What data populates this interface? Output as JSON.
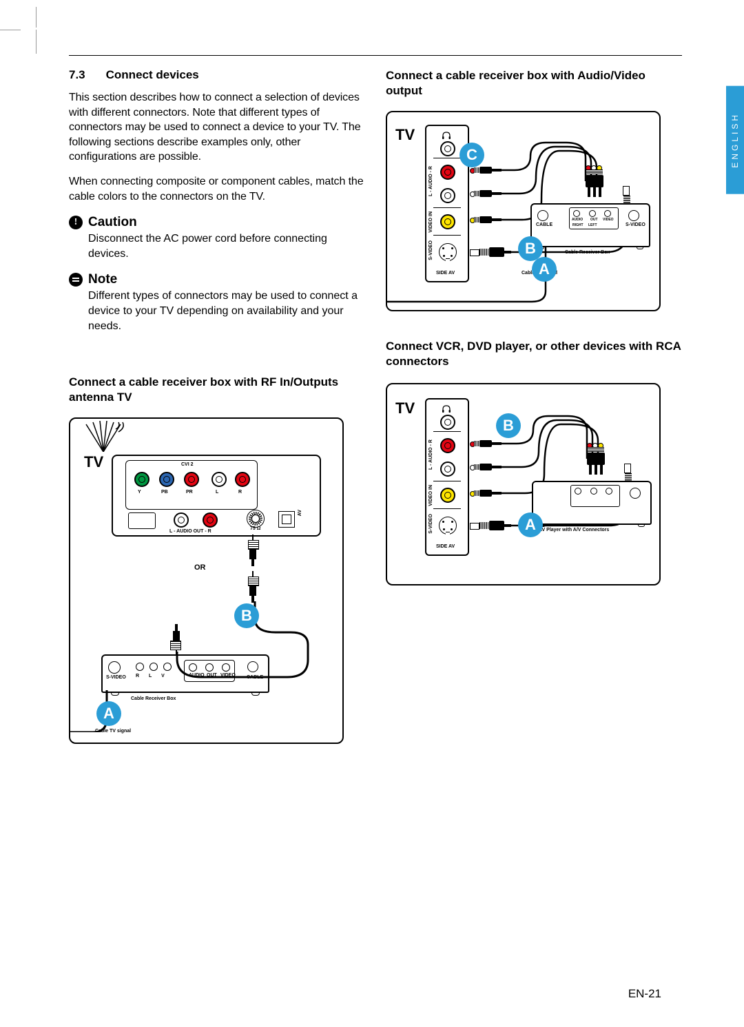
{
  "language_tab": "ENGLISH",
  "section": {
    "number": "7.3",
    "title": "Connect devices",
    "para1": "This section describes how to connect a selection of devices with different connectors. Note that different types of connectors may be used to connect a device to your TV.  The following sections describe examples only, other configurations are possible.",
    "para2": "When connecting composite or component cables, match the cable colors to the connectors on the TV."
  },
  "caution": {
    "label": "Caution",
    "body": "Disconnect the AC power cord before connecting devices."
  },
  "note": {
    "label": "Note",
    "body": "Different types of connectors may be used to connect a device to your TV depending on availability and your needs."
  },
  "subheads": {
    "left": "Connect a cable receiver box with RF In/Outputs antenna TV",
    "right_top": "Connect a cable receiver box with Audio/Video output",
    "right_bottom": "Connect  VCR, DVD player, or other devices with RCA connectors"
  },
  "page_number": "EN-21",
  "diagram_common": {
    "tv": "TV",
    "or": "OR",
    "label_A": "A",
    "label_B": "B",
    "label_C": "C",
    "side_av": "SIDE AV",
    "audio_lr": "L - AUDIO - R",
    "video_in": "VIDEO IN",
    "svideo": "S-VIDEO",
    "cable_receiver_box": "Cable Receiver Box",
    "cable_tv_signal": "Cable TV signal",
    "av_player": "AV Player with A/V Connectors"
  },
  "diagram1": {
    "panel_title": "CVI 2",
    "y": "Y",
    "pb": "PB",
    "pr": "PR",
    "l": "L",
    "r": "R",
    "audio_out": "L - AUDIO OUT - R",
    "ohm": "75 Ω",
    "av": "AV",
    "crb_labels": {
      "svideo": "S-VIDEO",
      "rlv": "R   L   V",
      "audio": "AUDIO",
      "out": "OUT",
      "video": "VIDEO",
      "cable": "CABLE"
    }
  },
  "diagram2": {
    "crb_labels": {
      "cable": "CABLE",
      "audio": "AUDIO",
      "right": "RIGHT",
      "left": "LEFT",
      "out": "OUT",
      "video": "VIDEO",
      "svideo": "S-VIDEO"
    }
  }
}
